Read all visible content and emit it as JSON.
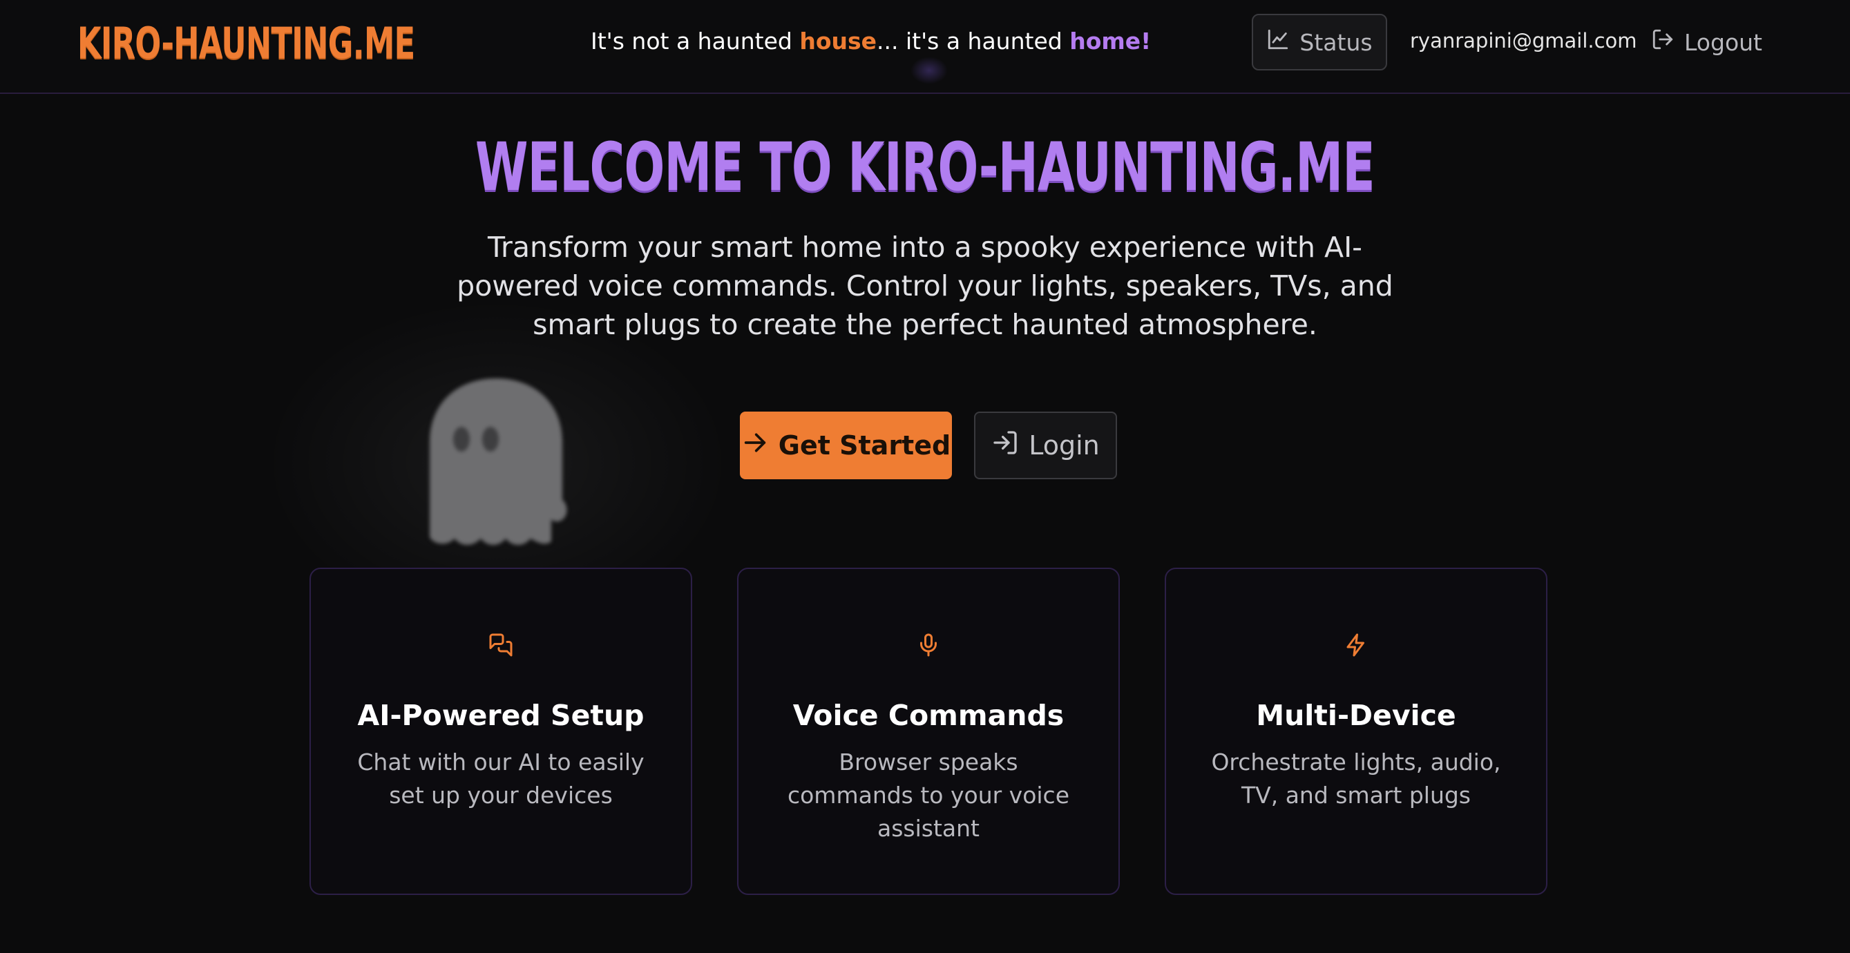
{
  "header": {
    "logo": "KIRO-HAUNTING.ME",
    "tagline": {
      "part1": "It's not a haunted ",
      "house": "house",
      "part2": "... it's a haunted ",
      "home": "home!"
    },
    "status_label": "Status",
    "email": "ryanrapini@gmail.com",
    "logout_label": "Logout"
  },
  "hero": {
    "title": "WELCOME TO KIRO-HAUNTING.ME",
    "subtitle": "Transform your smart home into a spooky experience with AI-powered voice commands. Control your lights, speakers, TVs, and smart plugs to create the perfect haunted atmosphere.",
    "get_started_label": "Get Started",
    "login_label": "Login"
  },
  "features": [
    {
      "icon": "chat-bubbles-icon",
      "title": "AI-Powered Setup",
      "description": "Chat with our AI to easily set up your devices"
    },
    {
      "icon": "microphone-icon",
      "title": "Voice Commands",
      "description": "Browser speaks commands to your voice assistant"
    },
    {
      "icon": "lightning-icon",
      "title": "Multi-Device",
      "description": "Orchestrate lights, audio, TV, and smart plugs"
    }
  ],
  "colors": {
    "accent_orange": "#ef7d33",
    "accent_purple": "#b17ef0",
    "background": "#0b0b0c",
    "card_border": "#2c1f47"
  }
}
